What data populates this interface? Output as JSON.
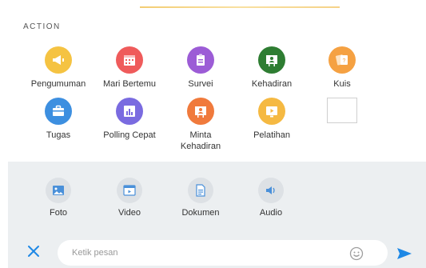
{
  "section": {
    "title": "ACTION"
  },
  "actions": [
    {
      "label": "Pengumuman",
      "icon": "megaphone-icon",
      "color": "#f5c342"
    },
    {
      "label": "Mari Bertemu",
      "icon": "calendar-icon",
      "color": "#ef5b5b"
    },
    {
      "label": "Survei",
      "icon": "clipboard-icon",
      "color": "#9c5cd6"
    },
    {
      "label": "Kehadiran",
      "icon": "attendance-board-icon",
      "color": "#2e7d32"
    },
    {
      "label": "Kuis",
      "icon": "quiz-cards-icon",
      "color": "#f5a142"
    },
    {
      "label": "Tugas",
      "icon": "briefcase-icon",
      "color": "#3d8fe0"
    },
    {
      "label": "Polling Cepat",
      "icon": "poll-chart-icon",
      "color": "#7a6be0"
    },
    {
      "label": "Minta Kehadiran",
      "icon": "request-attendance-icon",
      "color": "#f07a3c"
    },
    {
      "label": "Pelatihan",
      "icon": "training-play-icon",
      "color": "#f5b942"
    }
  ],
  "attachments": [
    {
      "label": "Foto",
      "icon": "photo-icon"
    },
    {
      "label": "Video",
      "icon": "video-icon"
    },
    {
      "label": "Dokumen",
      "icon": "document-icon"
    },
    {
      "label": "Audio",
      "icon": "audio-icon"
    }
  ],
  "composer": {
    "placeholder": "Ketik pesan"
  },
  "colors": {
    "accent": "#1e88e5",
    "panel": "#eceff1"
  }
}
